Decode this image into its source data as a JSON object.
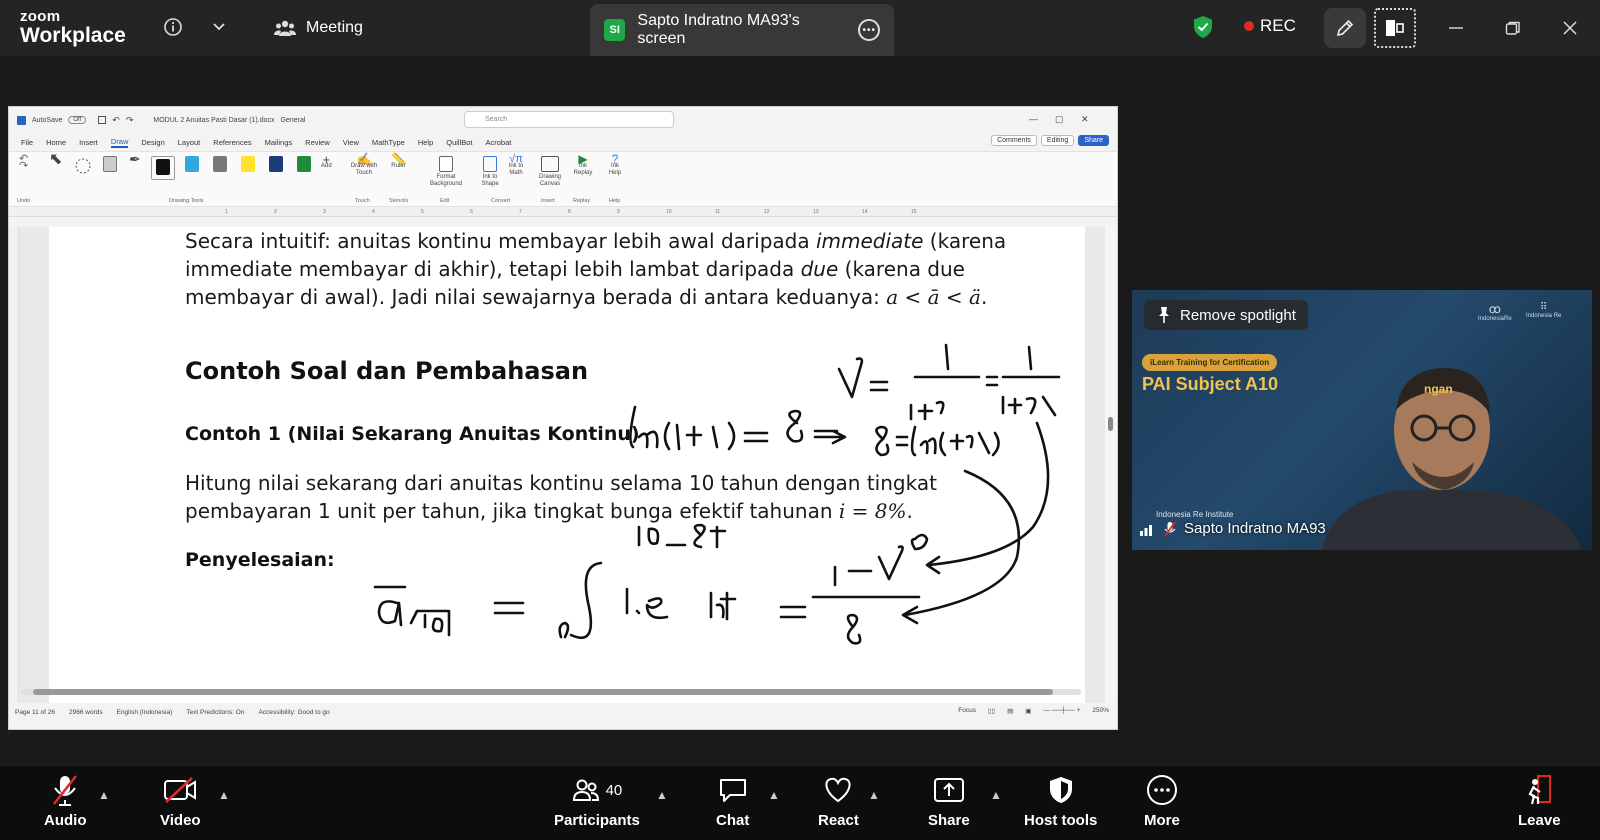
{
  "zoom": {
    "logo_line1": "zoom",
    "logo_line2": "Workplace",
    "meeting_label": "Meeting",
    "share_tab": {
      "initials": "SI",
      "title": "Sapto Indratno MA93's screen"
    },
    "rec_label": "REC",
    "accent_green": "#1fa84a",
    "rec_color": "#e02828"
  },
  "word": {
    "filename": "MODUL 2 Anuitas Pasti Dasar (1).docx",
    "autosave": "AutoSave",
    "autosave_state": "Off",
    "sensitivity": "General",
    "search_placeholder": "Search",
    "menu": [
      "File",
      "Home",
      "Insert",
      "Draw",
      "Design",
      "Layout",
      "References",
      "Mailings",
      "Review",
      "View",
      "MathType",
      "Help",
      "QuillBot",
      "Acrobat"
    ],
    "active_menu": "Draw",
    "comments_btn": "Comments",
    "editing_btn": "Editing",
    "share_btn": "Share",
    "ribbon": {
      "undo_group": "Undo",
      "drawing_tools_group": "Drawing Tools",
      "add_label": "Add",
      "draw_with_touch": "Draw with Touch",
      "ruler": "Ruler",
      "format_background": "Format Background",
      "ink_to_shape": "Ink to Shape",
      "ink_to_math": "Ink to Math",
      "drawing_canvas": "Drawing Canvas",
      "ink_replay": "Ink Replay",
      "ink_help": "Ink Help",
      "groups": [
        "Touch",
        "Stencils",
        "Edit",
        "Convert",
        "Insert",
        "Replay",
        "Help"
      ]
    },
    "ruler_marks": [
      "1",
      "2",
      "3",
      "4",
      "5",
      "6",
      "7",
      "8",
      "9",
      "10",
      "11",
      "12",
      "13",
      "14",
      "15"
    ],
    "document": {
      "para1_a": "Secara intuitif: anuitas kontinu membayar lebih awal daripada ",
      "para1_b": "immediate",
      "para1_c": " (karena",
      "para2_a": "immediate membayar di akhir), tetapi lebih lambat daripada ",
      "para2_b": "due",
      "para2_c": " (karena due",
      "para3_a": "membayar di awal). Jadi nilai sewajarnya berada di antara keduanya: ",
      "para3_math": "a < ā < ä",
      "para3_end": ".",
      "heading": "Contoh Soal dan Pembahasan",
      "subheading": "Contoh 1 (Nilai Sekarang Anuitas Kontinu)",
      "problem_1": "Hitung nilai sekarang dari anuitas kontinu selama 10 tahun dengan tingkat",
      "problem_2a": "pembayaran 1 unit per tahun, jika tingkat bunga efektif tahunan ",
      "problem_2_math": "i = 8%",
      "problem_2_end": ".",
      "solution_label": "Penyelesaian:"
    },
    "status": {
      "page": "Page 11 of 26",
      "words": "2966 words",
      "language": "English (Indonesia)",
      "predictions": "Text Predictions: On",
      "accessibility": "Accessibility: Good to go",
      "focus": "Focus",
      "zoom": "250%"
    }
  },
  "video": {
    "remove_spotlight": "Remove spotlight",
    "banner_pill": "iLearn Training for Certification",
    "banner_title": "PAI Subject A10",
    "banner_suffix": "ngan",
    "institute": "Indonesia Re Institute",
    "participant_name": "Sapto Indratno MA93",
    "logo_left": "IndonesiaRe",
    "logo_right": "Indonesia Re"
  },
  "toolbar": {
    "audio": "Audio",
    "video": "Video",
    "participants": "Participants",
    "participant_count": "40",
    "chat": "Chat",
    "react": "React",
    "share": "Share",
    "host_tools": "Host tools",
    "more": "More",
    "leave": "Leave"
  }
}
